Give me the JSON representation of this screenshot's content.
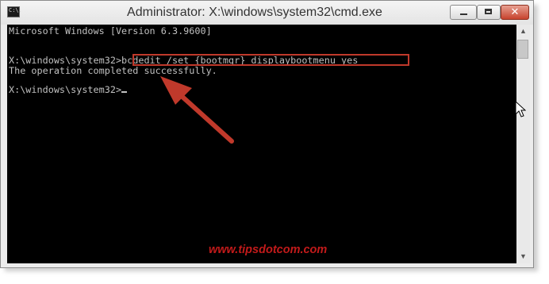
{
  "window": {
    "title": "Administrator: X:\\windows\\system32\\cmd.exe",
    "icon": "cmd-icon",
    "icon_text": "C:\\.",
    "buttons": {
      "minimize": "minimize-icon",
      "maximize": "maximize-icon",
      "close_glyph": "✕"
    }
  },
  "console": {
    "lines": [
      "Microsoft Windows [Version 6.3.9600]",
      "",
      "X:\\windows\\system32>bcdedit /set {bootmgr} displaybootmenu yes",
      "The operation completed successfully.",
      "",
      "X:\\windows\\system32>"
    ]
  },
  "annotation": {
    "arrow": "arrow-icon",
    "color": "#c0392b"
  },
  "watermark": "www.tipsdotcom.com",
  "colors": {
    "console_bg": "#000000",
    "console_text": "#c0c0c0",
    "accent": "#c0392b"
  }
}
